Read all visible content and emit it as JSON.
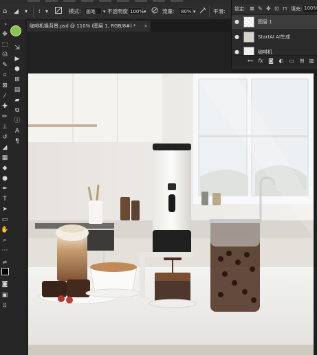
{
  "options_bar": {
    "mode_label": "模式:",
    "mode_value": "画笔",
    "opacity_label": "不透明度:",
    "opacity_value": "100%",
    "flow_label": "流量:",
    "flow_value": "80%",
    "smoothing_label": "平滑:"
  },
  "document": {
    "tab_title": "咖啡机换背景.psd @ 110% (图层 1, RGB/8#) *",
    "close": "×"
  },
  "layers_panel": {
    "lock_label": "锁定:",
    "fill_label": "填充:",
    "fill_value": "100%",
    "layers": [
      {
        "name": "图层 1",
        "visible_glyph": "●"
      },
      {
        "name": "StartAI AI生成",
        "visible_glyph": "●"
      },
      {
        "name": "咖啡机",
        "visible_glyph": "●"
      }
    ],
    "footer_icons": [
      "link-icon",
      "fx-icon",
      "mask-icon",
      "adjustment-icon",
      "group-icon",
      "new-layer-icon",
      "trash-icon"
    ]
  },
  "colors": {
    "accent_cursor": "#8bc34a",
    "panel_bg": "#2a2a2a",
    "ui_bg": "#1e1e1e"
  }
}
